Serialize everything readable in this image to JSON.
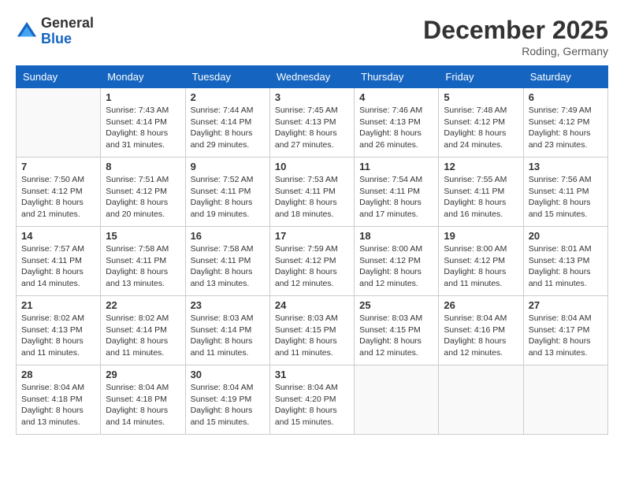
{
  "header": {
    "logo_general": "General",
    "logo_blue": "Blue",
    "month_title": "December 2025",
    "location": "Roding, Germany"
  },
  "calendar": {
    "weekdays": [
      "Sunday",
      "Monday",
      "Tuesday",
      "Wednesday",
      "Thursday",
      "Friday",
      "Saturday"
    ],
    "weeks": [
      [
        {
          "day": "",
          "sunrise": "",
          "sunset": "",
          "daylight": ""
        },
        {
          "day": "1",
          "sunrise": "Sunrise: 7:43 AM",
          "sunset": "Sunset: 4:14 PM",
          "daylight": "Daylight: 8 hours and 31 minutes."
        },
        {
          "day": "2",
          "sunrise": "Sunrise: 7:44 AM",
          "sunset": "Sunset: 4:14 PM",
          "daylight": "Daylight: 8 hours and 29 minutes."
        },
        {
          "day": "3",
          "sunrise": "Sunrise: 7:45 AM",
          "sunset": "Sunset: 4:13 PM",
          "daylight": "Daylight: 8 hours and 27 minutes."
        },
        {
          "day": "4",
          "sunrise": "Sunrise: 7:46 AM",
          "sunset": "Sunset: 4:13 PM",
          "daylight": "Daylight: 8 hours and 26 minutes."
        },
        {
          "day": "5",
          "sunrise": "Sunrise: 7:48 AM",
          "sunset": "Sunset: 4:12 PM",
          "daylight": "Daylight: 8 hours and 24 minutes."
        },
        {
          "day": "6",
          "sunrise": "Sunrise: 7:49 AM",
          "sunset": "Sunset: 4:12 PM",
          "daylight": "Daylight: 8 hours and 23 minutes."
        }
      ],
      [
        {
          "day": "7",
          "sunrise": "Sunrise: 7:50 AM",
          "sunset": "Sunset: 4:12 PM",
          "daylight": "Daylight: 8 hours and 21 minutes."
        },
        {
          "day": "8",
          "sunrise": "Sunrise: 7:51 AM",
          "sunset": "Sunset: 4:12 PM",
          "daylight": "Daylight: 8 hours and 20 minutes."
        },
        {
          "day": "9",
          "sunrise": "Sunrise: 7:52 AM",
          "sunset": "Sunset: 4:11 PM",
          "daylight": "Daylight: 8 hours and 19 minutes."
        },
        {
          "day": "10",
          "sunrise": "Sunrise: 7:53 AM",
          "sunset": "Sunset: 4:11 PM",
          "daylight": "Daylight: 8 hours and 18 minutes."
        },
        {
          "day": "11",
          "sunrise": "Sunrise: 7:54 AM",
          "sunset": "Sunset: 4:11 PM",
          "daylight": "Daylight: 8 hours and 17 minutes."
        },
        {
          "day": "12",
          "sunrise": "Sunrise: 7:55 AM",
          "sunset": "Sunset: 4:11 PM",
          "daylight": "Daylight: 8 hours and 16 minutes."
        },
        {
          "day": "13",
          "sunrise": "Sunrise: 7:56 AM",
          "sunset": "Sunset: 4:11 PM",
          "daylight": "Daylight: 8 hours and 15 minutes."
        }
      ],
      [
        {
          "day": "14",
          "sunrise": "Sunrise: 7:57 AM",
          "sunset": "Sunset: 4:11 PM",
          "daylight": "Daylight: 8 hours and 14 minutes."
        },
        {
          "day": "15",
          "sunrise": "Sunrise: 7:58 AM",
          "sunset": "Sunset: 4:11 PM",
          "daylight": "Daylight: 8 hours and 13 minutes."
        },
        {
          "day": "16",
          "sunrise": "Sunrise: 7:58 AM",
          "sunset": "Sunset: 4:11 PM",
          "daylight": "Daylight: 8 hours and 13 minutes."
        },
        {
          "day": "17",
          "sunrise": "Sunrise: 7:59 AM",
          "sunset": "Sunset: 4:12 PM",
          "daylight": "Daylight: 8 hours and 12 minutes."
        },
        {
          "day": "18",
          "sunrise": "Sunrise: 8:00 AM",
          "sunset": "Sunset: 4:12 PM",
          "daylight": "Daylight: 8 hours and 12 minutes."
        },
        {
          "day": "19",
          "sunrise": "Sunrise: 8:00 AM",
          "sunset": "Sunset: 4:12 PM",
          "daylight": "Daylight: 8 hours and 11 minutes."
        },
        {
          "day": "20",
          "sunrise": "Sunrise: 8:01 AM",
          "sunset": "Sunset: 4:13 PM",
          "daylight": "Daylight: 8 hours and 11 minutes."
        }
      ],
      [
        {
          "day": "21",
          "sunrise": "Sunrise: 8:02 AM",
          "sunset": "Sunset: 4:13 PM",
          "daylight": "Daylight: 8 hours and 11 minutes."
        },
        {
          "day": "22",
          "sunrise": "Sunrise: 8:02 AM",
          "sunset": "Sunset: 4:14 PM",
          "daylight": "Daylight: 8 hours and 11 minutes."
        },
        {
          "day": "23",
          "sunrise": "Sunrise: 8:03 AM",
          "sunset": "Sunset: 4:14 PM",
          "daylight": "Daylight: 8 hours and 11 minutes."
        },
        {
          "day": "24",
          "sunrise": "Sunrise: 8:03 AM",
          "sunset": "Sunset: 4:15 PM",
          "daylight": "Daylight: 8 hours and 11 minutes."
        },
        {
          "day": "25",
          "sunrise": "Sunrise: 8:03 AM",
          "sunset": "Sunset: 4:15 PM",
          "daylight": "Daylight: 8 hours and 12 minutes."
        },
        {
          "day": "26",
          "sunrise": "Sunrise: 8:04 AM",
          "sunset": "Sunset: 4:16 PM",
          "daylight": "Daylight: 8 hours and 12 minutes."
        },
        {
          "day": "27",
          "sunrise": "Sunrise: 8:04 AM",
          "sunset": "Sunset: 4:17 PM",
          "daylight": "Daylight: 8 hours and 13 minutes."
        }
      ],
      [
        {
          "day": "28",
          "sunrise": "Sunrise: 8:04 AM",
          "sunset": "Sunset: 4:18 PM",
          "daylight": "Daylight: 8 hours and 13 minutes."
        },
        {
          "day": "29",
          "sunrise": "Sunrise: 8:04 AM",
          "sunset": "Sunset: 4:18 PM",
          "daylight": "Daylight: 8 hours and 14 minutes."
        },
        {
          "day": "30",
          "sunrise": "Sunrise: 8:04 AM",
          "sunset": "Sunset: 4:19 PM",
          "daylight": "Daylight: 8 hours and 15 minutes."
        },
        {
          "day": "31",
          "sunrise": "Sunrise: 8:04 AM",
          "sunset": "Sunset: 4:20 PM",
          "daylight": "Daylight: 8 hours and 15 minutes."
        },
        {
          "day": "",
          "sunrise": "",
          "sunset": "",
          "daylight": ""
        },
        {
          "day": "",
          "sunrise": "",
          "sunset": "",
          "daylight": ""
        },
        {
          "day": "",
          "sunrise": "",
          "sunset": "",
          "daylight": ""
        }
      ]
    ]
  }
}
